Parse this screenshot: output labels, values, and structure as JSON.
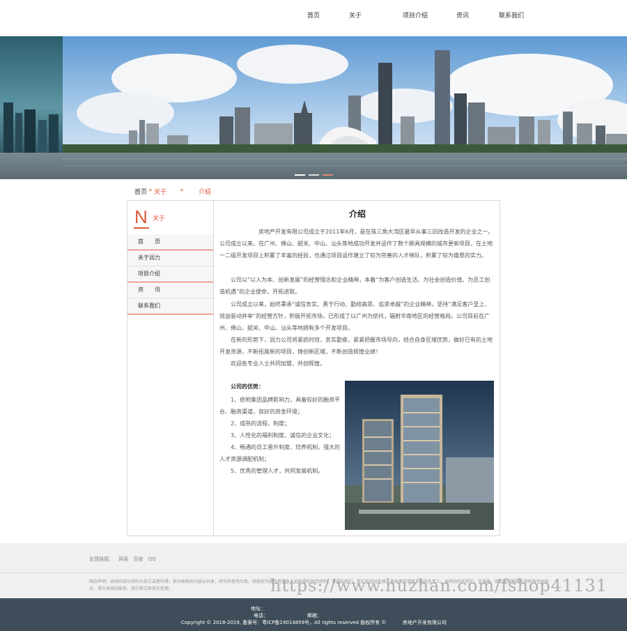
{
  "nav": {
    "items": [
      "首页",
      "关于",
      "项目介绍",
      "资讯",
      "联系我们"
    ]
  },
  "breadcrumb": {
    "home": "首页",
    "sep1": "»",
    "about": "关于",
    "sep2": "»",
    "current": "介绍"
  },
  "sidebar": {
    "letter": "N",
    "title": "关于",
    "items": [
      "首　　页",
      "关于润力",
      "项目介绍",
      "资　　讯",
      "联系我们"
    ]
  },
  "content": {
    "title": "介绍",
    "paragraphs": [
      "　　　　　　　房地产开发有限公司成立于2011年6月，是在珠三角大湾区最早从事三旧改造开发的企业之一。公司成立以来，在广州、佛山、韶关、中山、汕头等地成功开发并运作了数个颇具规模的城市更新项目，在土地一二级开发项目上积累了丰富的经验，也通过项目运作建立了较为完善的人才梯队，积累了较为雄厚的实力。",
      "　　公司以“以人为本、创新发展”的经营理念和企业精神，本着“为客户创造生活、为社会创造价值、为员工创造机遇”的企业使命，开拓进取。",
      "　　公司成立以来，始终秉承“诚信务实、勇于行动、勤结高思、追求卓越”的企业精神，坚持“满足客户至上、效益驱动并举”的经营方针，积极开拓市场，已形成了以广州为依托，辐射华南地区的经营格局。公司目前在广州、佛山、韶关、中山、汕头等地拥有多个开发项目。",
      "　　在新的形势下，润力公司将紧抓时效，务实勤奋，紧紧把握市场导向，结合自身区域优势，做好已有的土地开发资源，不断拓展新的项目，铸创新区域，不断创造辉煌业绩！",
      "　　欢迎各专业人士共同加盟，共创辉煌。"
    ],
    "advantages_title": "公司的优势：",
    "advantages": [
      "　　1、依附集团品牌影响力，具备较好的融资平台、融资渠道，良好的资金环境；",
      "　　2、成熟的流程、制度；",
      "　　3、人性化的福利制度、诚信的企业文化；",
      "　　4、畅通的员工晋升制度、培养机制，强大的人才资源调配机制；",
      "　　5、优秀的管理人才，共同发展机制。"
    ]
  },
  "footer": {
    "links_label": "友情链接：",
    "links": [
      "网易",
      "百度",
      "QQ"
    ],
    "disclaimer": "网站声明：本网站部分资料为自方或者所得，其中图表的内容以共享，研究和使用为目，其版权为原作者所有，如有侵犯到您权利，请通知我们。我们将及时处理。具体事项请联系相关负责人。本网站的不规范，不准确，如您对被摘要的资料有任何异议，请与本网站联系，我们将立即核实处理。",
    "address_label": "地址：",
    "phone_label": "电话：",
    "email_label": "邮箱：",
    "copyright": "Copyright © 2018-2019, 备案号：粤ICP备19014859号，All rights reserved 版权所有 ©",
    "company": "房地产开发有限公司"
  },
  "watermark": "https://www.huzhan.com/fshop41131",
  "colors": {
    "accent": "#e05a3c",
    "footer_dark": "#3f4d5a"
  }
}
